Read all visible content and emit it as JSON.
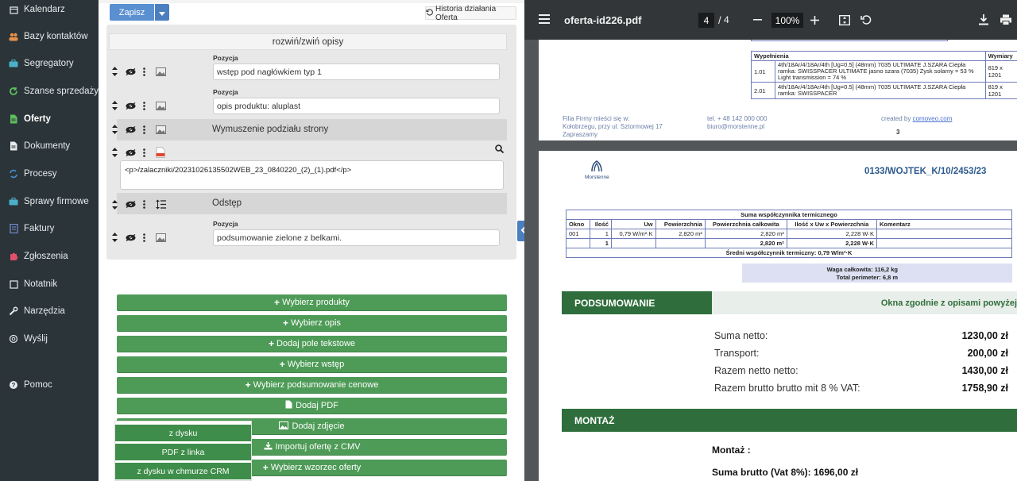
{
  "sidebar": {
    "items": [
      {
        "label": "Kalendarz",
        "icon": "calendar-icon",
        "color": "#e7ecee"
      },
      {
        "label": "Bazy kontaktów",
        "icon": "users-icon",
        "color": "#e8904a"
      },
      {
        "label": "Segregatory",
        "icon": "briefcase-icon",
        "color": "#4bb0c9"
      },
      {
        "label": "Szanse sprzedaży",
        "icon": "refresh-icon",
        "color": "#5fbf5f"
      },
      {
        "label": "Oferty",
        "icon": "document-icon",
        "color": "#5fbf5f"
      },
      {
        "label": "Dokumenty",
        "icon": "file-icon",
        "color": "#e7ecee"
      },
      {
        "label": "Procesy",
        "icon": "cycle-icon",
        "color": "#4b8fd9"
      },
      {
        "label": "Sprawy firmowe",
        "icon": "briefcase-icon",
        "color": "#4bb0c9"
      },
      {
        "label": "Faktury",
        "icon": "invoice-icon",
        "color": "#7b8fd9"
      },
      {
        "label": "Zgłoszenia",
        "icon": "puzzle-icon",
        "color": "#e0506a"
      },
      {
        "label": "Notatnik",
        "icon": "note-icon",
        "color": "#e7ecee"
      },
      {
        "label": "Narzędzia",
        "icon": "wrench-icon",
        "color": "#e7ecee"
      },
      {
        "label": "Wyślij",
        "icon": "at-icon",
        "color": "#e7ecee"
      },
      {
        "label": "Pomoc",
        "icon": "help-icon",
        "color": "#e7ecee"
      }
    ],
    "active": "Oferty"
  },
  "editor": {
    "save_label": "Zapisz",
    "history_label": "Historia działania Oferta",
    "toggle_label": "rozwiń/zwiń opisy",
    "position_label": "Pozycja",
    "rows": {
      "r1": "wstęp pod nagłówkiem typ 1",
      "r2": "opis produktu: aluplast",
      "r3": "Wymuszenie podziału strony",
      "r4": "<p>/zalaczniki/20231026135502WEB_23_0840220_(2)_(1).pdf</p>",
      "r5": "Odstęp",
      "r6": "podsumowanie zielone z belkami."
    },
    "buttons": [
      "Wybierz produkty",
      "Wybierz opis",
      "Dodaj pole tekstowe",
      "Wybierz wstęp",
      "Wybierz podsumowanie cenowe",
      "Dodaj PDF",
      "Dodaj zdjęcie",
      "Importuj ofertę z CMV",
      "Wybierz wzorzec oferty"
    ],
    "dropdown": [
      "z dysku",
      "PDF z linka",
      "z dysku w chmurze CRM"
    ]
  },
  "viewer": {
    "filename": "oferta-id226.pdf",
    "page_current": "4",
    "page_total": "4",
    "zoom": "100%",
    "page1": {
      "table_headers": [
        "Wypełnienia",
        "Wymiary"
      ],
      "rows": [
        {
          "no": "1.01",
          "desc": "4th/18Ar/4/18Ar/4th [Ug=0.5] (48mm) 7035 ULTIMATE J.SZARA Ciepła ramka: SWISSPACER ULTIMATE jasno szara (7035) Zysk solarny = 53 % Light transmission = 74 %",
          "dim": "819 x 1201"
        },
        {
          "no": "2.01",
          "desc": "4th/18Ar/4/18Ar/4th [Ug=0.5] (48mm) 7035 ULTIMATE J.SZARA Ciepła ramka: SWISSPACER",
          "dim": "819 x 1201"
        }
      ],
      "footer_left": [
        "Filia Firmy mieści się w:",
        "Kołobrzegu, przy ul. Sztormowej 17",
        "Zapraszamy"
      ],
      "footer_mid": [
        "tel. + 48 142 000 000",
        "biuro@morstenne.pl"
      ],
      "footer_right": "created by",
      "footer_link": "comoveo.com",
      "page_no": "3"
    },
    "page2": {
      "logo_text": "Morstenne",
      "offer_no": "0133/WOJTEK_K/10/2453/23",
      "table_title": "Suma współczynnika termicznego",
      "table_headers": [
        "Okno",
        "Ilość",
        "Uw",
        "Powierzchnia",
        "Powierzchnia całkowita",
        "Ilość x Uw x Powierzchnia",
        "Komentarz"
      ],
      "table_row": [
        "001",
        "1",
        "0,79 W/m²·K",
        "2,820 m²",
        "2,820 m²",
        "2,228 W·K",
        ""
      ],
      "table_total": [
        "",
        "1",
        "",
        "",
        "2,820 m²",
        "2,228 W·K",
        ""
      ],
      "avg_label": "Średni współczynnik termiczny: 0,79 W/m²·K",
      "weight": "Waga całkowita: 116,2 kg",
      "perimeter": "Total perimeter: 6,8 m",
      "summary_title": "PODSUMOWANIE",
      "summary_note": "Okna zgodnie z opisami powyżej",
      "summary_rows": [
        {
          "label": "Suma netto:",
          "value": "1230,00 zł"
        },
        {
          "label": "Transport:",
          "value": "200,00 zł"
        },
        {
          "label": "Razem netto netto:",
          "value": "1430,00 zł"
        },
        {
          "label": "Razem brutto brutto mit 8 % VAT:",
          "value": "1758,90 zł"
        }
      ],
      "montaz_title": "MONTAŻ",
      "montaz_label": "Montaż :",
      "montaz_total": "Suma brutto (Vat 8%): 1696,00 zł"
    }
  },
  "colors": {
    "sidebar_bg": "#2b3438",
    "primary": "#5a8fd0",
    "green": "#4e9b57",
    "summary_green": "#2f6e3c",
    "viewer_bg": "#525659"
  }
}
